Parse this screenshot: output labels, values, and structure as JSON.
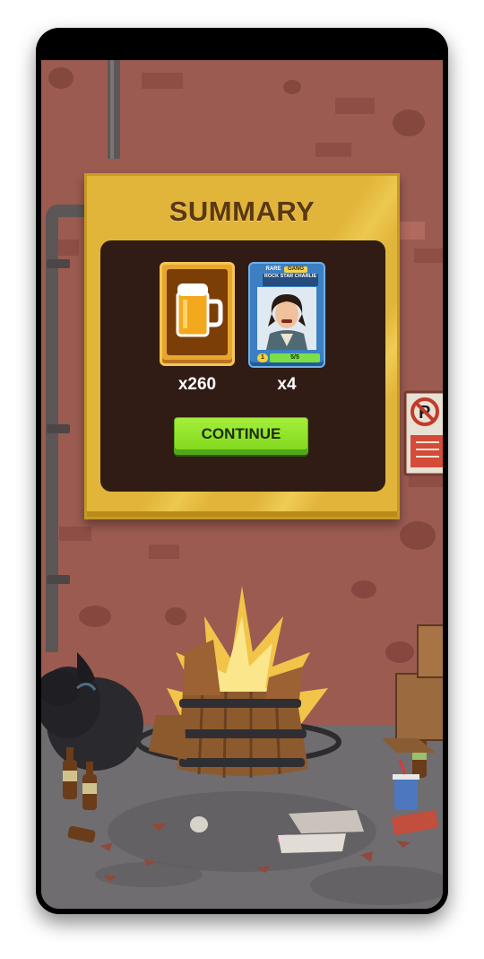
{
  "summary": {
    "title": "SUMMARY",
    "rewards": [
      {
        "item": "beer",
        "icon": "beer-mug-icon",
        "quantity": "x260"
      },
      {
        "item": "character-card",
        "rarity": "RARE",
        "type": "GANG",
        "name": "ROCK STAR CHARLIE",
        "level": "1",
        "count": "5/5",
        "quantity": "x4"
      }
    ],
    "continue_label": "CONTINUE"
  },
  "colors": {
    "panel_gold": "#e1b43a",
    "panel_inner": "#301c14",
    "button_green": "#8ee02a",
    "wall": "#9a5a50"
  }
}
